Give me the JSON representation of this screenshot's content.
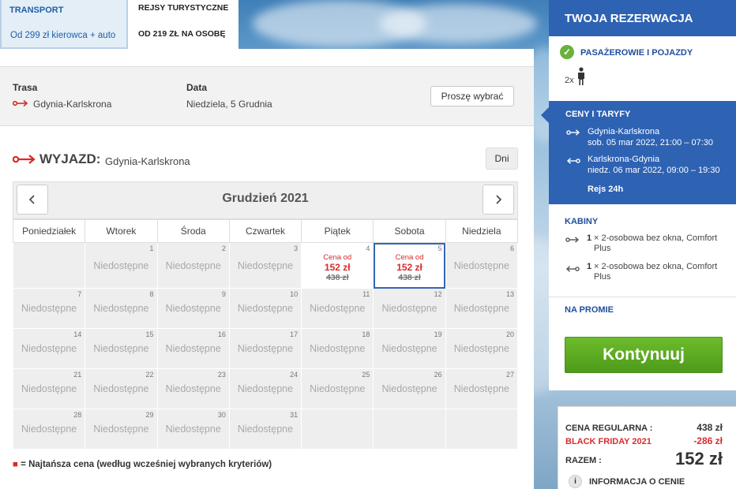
{
  "tabs": {
    "transport": {
      "title": "TRANSPORT",
      "sub": "Od 299 zł kierowca + auto"
    },
    "cruises": {
      "title": "REJSY TURYSTYCZNE",
      "sub": "OD 219 ZŁ NA OSOBĘ"
    }
  },
  "route_bar": {
    "route_label": "Trasa",
    "route_value": "Gdynia-Karlskrona",
    "date_label": "Data",
    "date_value": "Niedziela, 5 Grudnia",
    "choose_button": "Proszę wybrać"
  },
  "departure": {
    "title": "WYJAZD:",
    "route": "Gdynia-Karlskrona",
    "days_button": "Dni"
  },
  "calendar": {
    "month": "Grudzień 2021",
    "weekdays": [
      "Poniedziałek",
      "Wtorek",
      "Środa",
      "Czwartek",
      "Piątek",
      "Sobota",
      "Niedziela"
    ],
    "unavailable_text": "Niedostępne",
    "price_from_label": "Cena od",
    "price_4": {
      "price": "152 zł",
      "old": "438 zł"
    },
    "price_5": {
      "price": "152 zł",
      "old": "438 zł"
    }
  },
  "legend": {
    "marker": "■",
    "text": "= Najtańsza cena (według wcześniej wybranych kryteriów)"
  },
  "sidebar": {
    "title": "TWOJA REZERWACJA",
    "passengers_label": "PASAŻEROWIE I POJAZDY",
    "passengers_count": "2x",
    "prices_title": "CENY I TARYFY",
    "out_route": "Gdynia-Karlskrona",
    "out_time": "sob. 05 mar 2022, 21:00 – 07:30",
    "ret_route": "Karlskrona-Gdynia",
    "ret_time": "niedz. 06 mar 2022, 09:00 – 19:30",
    "cruise_note": "Rejs 24h",
    "cabins_title": "KABINY",
    "cabin1_qty": "1",
    "cabin1_text": "× 2-osobowa bez okna, Comfort Plus",
    "cabin2_qty": "1",
    "cabin2_text": "× 2-osobowa bez okna, Comfort Plus",
    "onboard_title": "NA PROMIE",
    "continue_button": "Kontynuuj",
    "regular_label": "CENA REGULARNA :",
    "regular_value": "438 zł",
    "bf_label": "BLACK FRIDAY 2021",
    "bf_value": "-286 zł",
    "total_label": "RAZEM :",
    "total_value": "152 zł",
    "info_label": "INFORMACJA O CENIE"
  },
  "colors": {
    "brand_blue": "#2e62b3",
    "accent_red": "#d92b2b",
    "continue_green": "#5aa621"
  }
}
